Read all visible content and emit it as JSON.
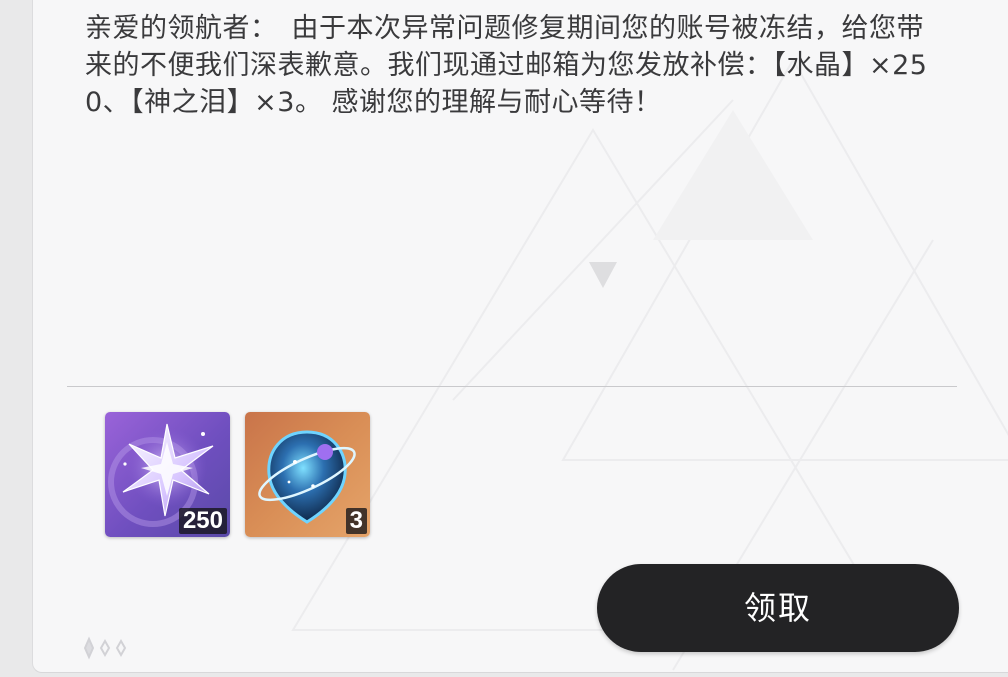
{
  "mail": {
    "body": "亲爱的领航者：　由于本次异常问题修复期间您的账号被冻结，给您带来的不便我们深表歉意。我们现通过邮箱为您发放补偿：【水晶】×250、【神之泪】×3。 感谢您的理解与耐心等待！"
  },
  "rewards": [
    {
      "icon": "crystal-icon",
      "count": "250",
      "color": "#7a55c8"
    },
    {
      "icon": "tear-of-god-icon",
      "count": "3",
      "color": "#d98e56"
    }
  ],
  "actions": {
    "claim_label": "领取"
  },
  "colors": {
    "button_bg": "#232325",
    "panel_bg": "#f7f7f8",
    "text": "#3a3a3c"
  }
}
